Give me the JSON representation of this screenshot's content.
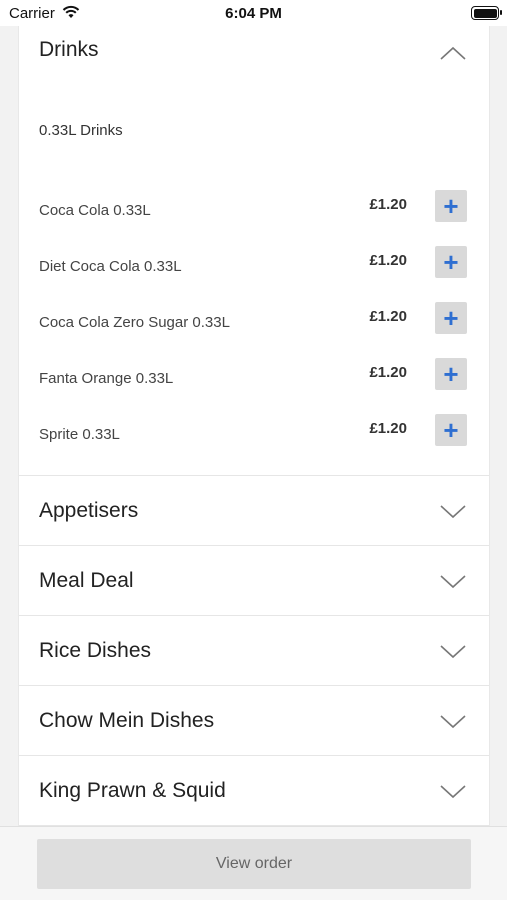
{
  "status_bar": {
    "carrier": "Carrier",
    "time": "6:04 PM"
  },
  "menu": {
    "drinks": {
      "title": "Drinks",
      "subheading": "0.33L Drinks",
      "items": [
        {
          "name": "Coca Cola 0.33L",
          "price": "£1.20"
        },
        {
          "name": "Diet Coca Cola 0.33L",
          "price": "£1.20"
        },
        {
          "name": "Coca Cola Zero Sugar 0.33L",
          "price": "£1.20"
        },
        {
          "name": "Fanta Orange 0.33L",
          "price": "£1.20"
        },
        {
          "name": "Sprite 0.33L",
          "price": "£1.20"
        }
      ],
      "add_label": "+"
    },
    "sections": [
      {
        "title": "Appetisers"
      },
      {
        "title": "Meal Deal"
      },
      {
        "title": "Rice Dishes"
      },
      {
        "title": "Chow Mein Dishes"
      },
      {
        "title": "King Prawn & Squid"
      }
    ]
  },
  "footer": {
    "view_order_label": "View order"
  },
  "colors": {
    "accent": "#2f6fd1",
    "button_bg": "#d9d9d9"
  }
}
